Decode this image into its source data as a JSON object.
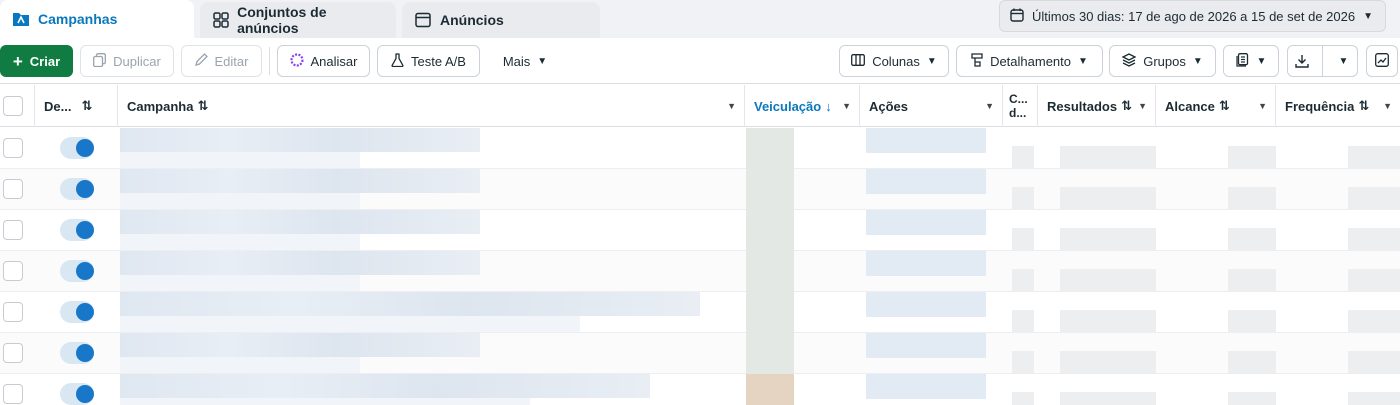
{
  "tabs": [
    {
      "label": "Campanhas",
      "active": true,
      "icon": "folder-icon"
    },
    {
      "label": "Conjuntos de anúncios",
      "active": false,
      "icon": "grid-icon"
    },
    {
      "label": "Anúncios",
      "active": false,
      "icon": "ad-window-icon"
    }
  ],
  "date_range": {
    "label": "Últimos 30 dias: 17 de ago de 2026 a 15 de set de 2026",
    "icon": "calendar-icon"
  },
  "toolbar": {
    "create": "Criar",
    "duplicate": "Duplicar",
    "edit": "Editar",
    "analyze": "Analisar",
    "ab_test": "Teste A/B",
    "more": "Mais",
    "columns": "Colunas",
    "breakdown": "Detalhamento",
    "groups": "Grupos"
  },
  "columns": [
    {
      "label": "De...",
      "sortable": true
    },
    {
      "label": "Campanha",
      "sortable": true
    },
    {
      "label": "Veiculação",
      "sortable": true,
      "sorted": "desc"
    },
    {
      "label": "Ações",
      "sortable": false
    },
    {
      "label": "C... d...",
      "sortable": false
    },
    {
      "label": "Resultados",
      "sortable": true
    },
    {
      "label": "Alcance",
      "sortable": true
    },
    {
      "label": "Frequência",
      "sortable": true
    }
  ],
  "rows": [
    {
      "enabled": true
    },
    {
      "enabled": true
    },
    {
      "enabled": true
    },
    {
      "enabled": true
    },
    {
      "enabled": true
    },
    {
      "enabled": true
    },
    {
      "enabled": true
    }
  ],
  "colors": {
    "accent": "#0a78be",
    "primary_button": "#107c41",
    "toggle_knob": "#1877c9"
  }
}
